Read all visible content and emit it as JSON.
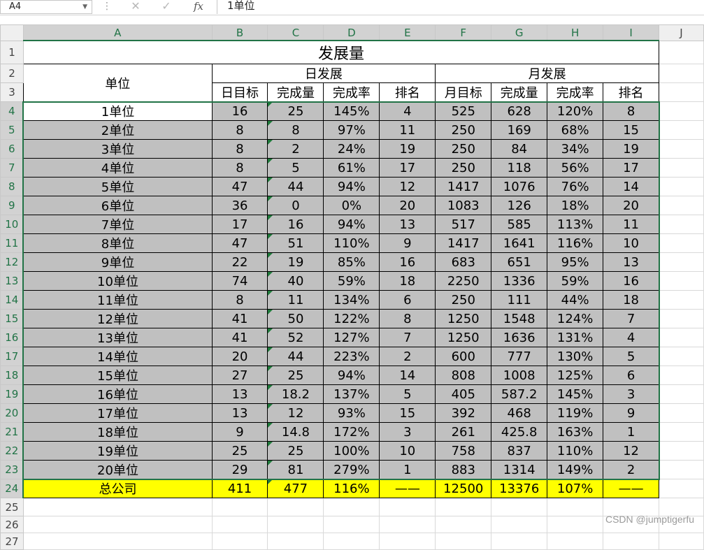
{
  "formula_bar": {
    "name_box": "A4",
    "cancel_icon": "✕",
    "enter_icon": "✓",
    "fx_label": "fx",
    "content": "1单位"
  },
  "columns": [
    "A",
    "B",
    "C",
    "D",
    "E",
    "F",
    "G",
    "H",
    "I",
    "J"
  ],
  "rows": [
    "1",
    "2",
    "3",
    "4",
    "5",
    "6",
    "7",
    "8",
    "9",
    "10",
    "11",
    "12",
    "13",
    "14",
    "15",
    "16",
    "17",
    "18",
    "19",
    "20",
    "21",
    "22",
    "23",
    "24",
    "25",
    "26",
    "27"
  ],
  "sheet": {
    "title": "发展量",
    "unit_header": "单位",
    "daily_group": "日发展",
    "monthly_group": "月发展",
    "sub_headers": [
      "日目标",
      "完成量",
      "完成率",
      "排名",
      "月目标",
      "完成量",
      "完成率",
      "排名"
    ],
    "data": [
      [
        "1单位",
        "16",
        "25",
        "145%",
        "4",
        "525",
        "628",
        "120%",
        "8"
      ],
      [
        "2单位",
        "8",
        "8",
        "97%",
        "11",
        "250",
        "169",
        "68%",
        "15"
      ],
      [
        "3单位",
        "8",
        "2",
        "24%",
        "19",
        "250",
        "84",
        "34%",
        "19"
      ],
      [
        "4单位",
        "8",
        "5",
        "61%",
        "17",
        "250",
        "118",
        "56%",
        "17"
      ],
      [
        "5单位",
        "47",
        "44",
        "94%",
        "12",
        "1417",
        "1076",
        "76%",
        "14"
      ],
      [
        "6单位",
        "36",
        "0",
        "0%",
        "20",
        "1083",
        "126",
        "18%",
        "20"
      ],
      [
        "7单位",
        "17",
        "16",
        "94%",
        "13",
        "517",
        "585",
        "113%",
        "11"
      ],
      [
        "8单位",
        "47",
        "51",
        "110%",
        "9",
        "1417",
        "1641",
        "116%",
        "10"
      ],
      [
        "9单位",
        "22",
        "19",
        "85%",
        "16",
        "683",
        "651",
        "95%",
        "13"
      ],
      [
        "10单位",
        "74",
        "40",
        "59%",
        "18",
        "2250",
        "1336",
        "59%",
        "16"
      ],
      [
        "11单位",
        "8",
        "11",
        "134%",
        "6",
        "250",
        "111",
        "44%",
        "18"
      ],
      [
        "12单位",
        "41",
        "50",
        "122%",
        "8",
        "1250",
        "1548",
        "124%",
        "7"
      ],
      [
        "13单位",
        "41",
        "52",
        "127%",
        "7",
        "1250",
        "1636",
        "131%",
        "4"
      ],
      [
        "14单位",
        "20",
        "44",
        "223%",
        "2",
        "600",
        "777",
        "130%",
        "5"
      ],
      [
        "15单位",
        "27",
        "25",
        "94%",
        "14",
        "808",
        "1008",
        "125%",
        "6"
      ],
      [
        "16单位",
        "13",
        "18.2",
        "137%",
        "5",
        "405",
        "587.2",
        "145%",
        "3"
      ],
      [
        "17单位",
        "13",
        "12",
        "93%",
        "15",
        "392",
        "468",
        "119%",
        "9"
      ],
      [
        "18单位",
        "9",
        "14.8",
        "172%",
        "3",
        "261",
        "425.8",
        "163%",
        "1"
      ],
      [
        "19单位",
        "25",
        "25",
        "100%",
        "10",
        "758",
        "837",
        "110%",
        "12"
      ],
      [
        "20单位",
        "29",
        "81",
        "279%",
        "1",
        "883",
        "1314",
        "149%",
        "2"
      ]
    ],
    "total": [
      "总公司",
      "411",
      "477",
      "116%",
      "——",
      "12500",
      "13376",
      "107%",
      "——"
    ]
  },
  "watermark": "CSDN @jumptigerfu",
  "colors": {
    "accent": "#217346",
    "highlight_fill": "#c0c0c0",
    "total_fill": "#ffff00"
  }
}
